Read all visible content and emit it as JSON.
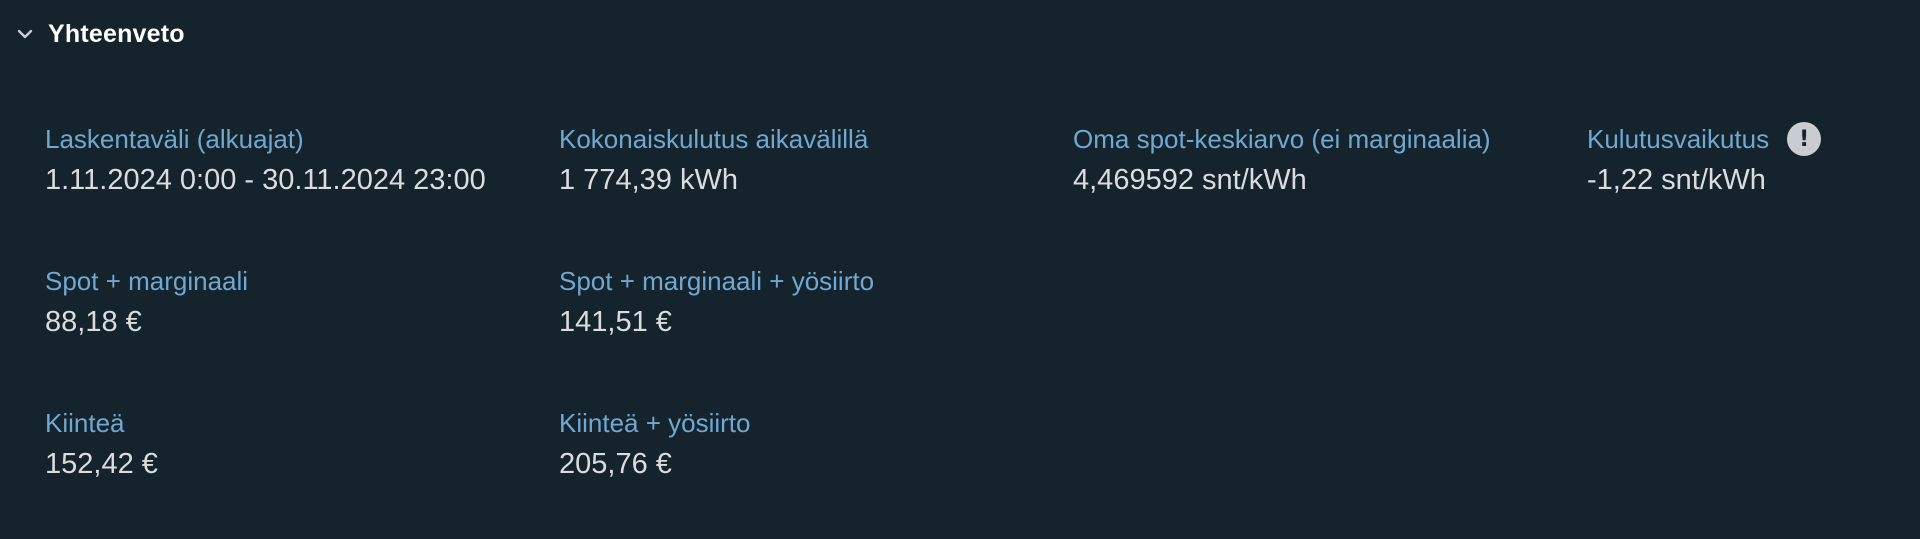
{
  "section": {
    "title": "Yhteenveto",
    "toggle_icon": "chevron-down-icon"
  },
  "summary": {
    "range": {
      "label": "Laskentaväli (alkuajat)",
      "value": "1.11.2024 0:00 - 30.11.2024 23:00"
    },
    "total_consumption": {
      "label": "Kokonaiskulutus aikavälillä",
      "value": "1 774,39 kWh"
    },
    "own_spot_average": {
      "label": "Oma spot-keskiarvo (ei marginaalia)",
      "value": "4,469592 snt/kWh"
    },
    "consumption_effect": {
      "label": "Kulutusvaikutus",
      "value": "-1,22 snt/kWh",
      "icon": "!",
      "icon_name": "info-icon"
    },
    "spot_margin": {
      "label": "Spot + marginaali",
      "value": "88,18 €"
    },
    "spot_margin_night": {
      "label": "Spot + marginaali + yösiirto",
      "value": "141,51 €"
    },
    "fixed": {
      "label": "Kiinteä",
      "value": "152,42 €"
    },
    "fixed_night": {
      "label": "Kiinteä + yösiirto",
      "value": "205,76 €"
    }
  },
  "colors": {
    "background": "#15232c",
    "label": "#6fa8d0",
    "value": "#d9dde0",
    "title": "#ffffff"
  }
}
